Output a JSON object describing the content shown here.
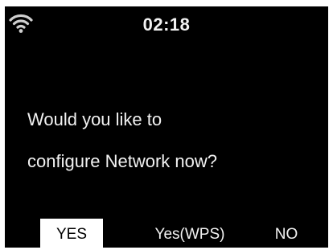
{
  "status_bar": {
    "wifi_icon": "wifi-icon",
    "time": "02:18"
  },
  "dialog": {
    "line1": "Would you like to",
    "line2": "configure Network now?"
  },
  "options": {
    "yes": "YES",
    "yes_wps": "Yes(WPS)",
    "no": "NO",
    "selected": "YES"
  },
  "colors": {
    "screen_background": "#000000",
    "text": "#f2f2f2",
    "selection_background": "#ffffff",
    "selection_text": "#000000"
  }
}
